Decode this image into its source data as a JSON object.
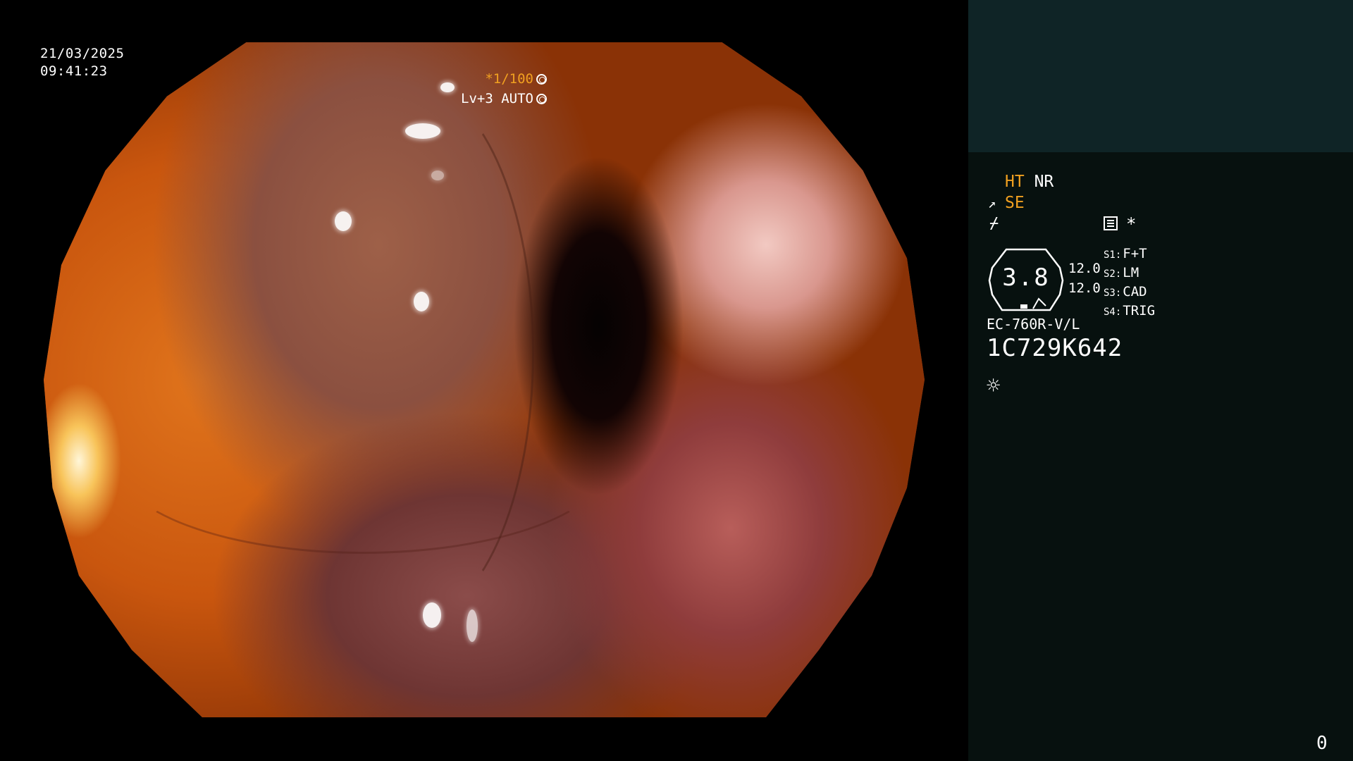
{
  "overlay": {
    "date": "21/03/2025",
    "time": "09:41:23",
    "shutter": "*1/100",
    "level": "Lv+3 AUTO"
  },
  "panel": {
    "ht": "HT",
    "nr": "NR",
    "se": "SE",
    "function_symbol": "⌿",
    "star": "*",
    "gauge_value": "3.8",
    "num_top": "12.0",
    "num_bottom": "12.0",
    "switches": [
      {
        "key": "S1:",
        "value": "F+T"
      },
      {
        "key": "S2:",
        "value": "LM"
      },
      {
        "key": "S3:",
        "value": "CAD"
      },
      {
        "key": "S4:",
        "value": "TRIG"
      }
    ],
    "model": "EC-760R-V/L",
    "serial": "1C729K642",
    "counter": "0"
  },
  "colors": {
    "highlight": "#f0a020",
    "panel_top": "#0f2426",
    "panel_bottom": "#07110f"
  },
  "icons": [
    "aperture-icon",
    "iris-icon",
    "menu-icon",
    "brightness-icon",
    "edge-enhance-icon"
  ]
}
